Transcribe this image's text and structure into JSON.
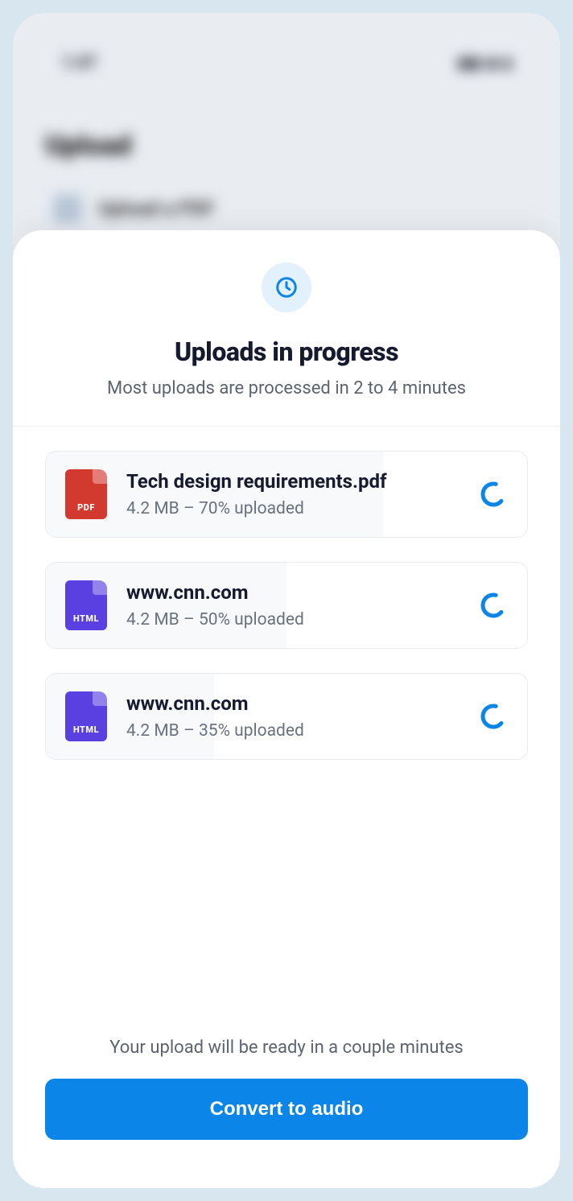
{
  "background": {
    "time": "1:47",
    "title": "Upload",
    "item_label": "Upload a PDF"
  },
  "sheet": {
    "title": "Uploads in progress",
    "subtitle": "Most uploads are processed in 2 to 4 minutes",
    "footer_note": "Your upload will be ready in a couple minutes",
    "cta_label": "Convert to audio"
  },
  "uploads": [
    {
      "name": "Tech design requirements.pdf",
      "meta": "4.2 MB – 70% uploaded",
      "type": "PDF",
      "percent": 70,
      "icon_class": "pdf"
    },
    {
      "name": "www.cnn.com",
      "meta": "4.2 MB – 50% uploaded",
      "type": "HTML",
      "percent": 50,
      "icon_class": "html"
    },
    {
      "name": "www.cnn.com",
      "meta": "4.2 MB – 35% uploaded",
      "type": "HTML",
      "percent": 35,
      "icon_class": "html"
    }
  ],
  "colors": {
    "accent": "#0b86e8"
  }
}
